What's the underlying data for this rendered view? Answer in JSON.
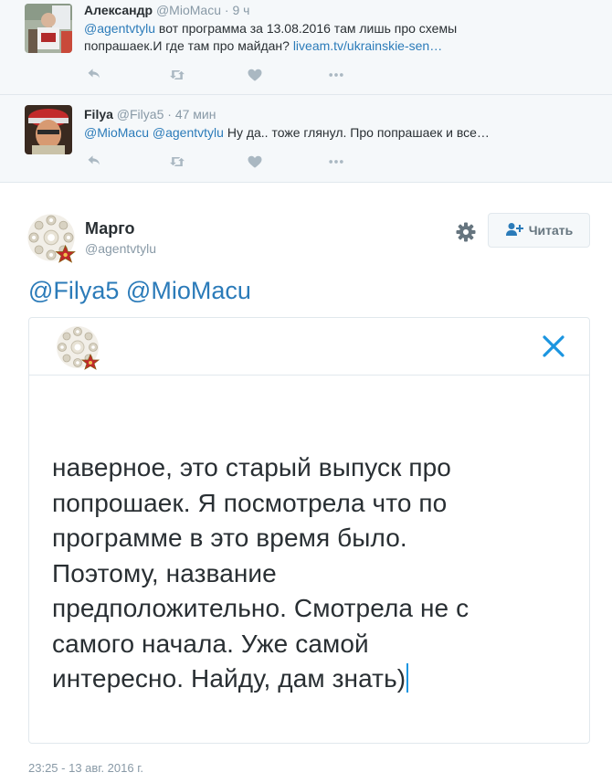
{
  "replies": [
    {
      "name": "Александр",
      "handle": "@MioMacu",
      "time": "9 ч",
      "text_mention": "@agentvtylu",
      "text_body_line1": "  вот программа за 13.08.2016 там лишь про схемы",
      "text_body_line2": "попрашаек.И где там про майдан? ",
      "text_link": "liveam.tv/ukrainskie-sen…"
    },
    {
      "name": "Filya",
      "handle": "@Filya5",
      "time": "47 мин",
      "text_mention": "@MioMacu @agentvtylu",
      "text_body": " Ну да.. тоже глянул. Про попрашаек и все…"
    }
  ],
  "icons": [
    "reply-icon",
    "retweet-icon",
    "like-icon",
    "more-icon",
    "gear-icon",
    "follow-icon",
    "close-icon"
  ],
  "tweet": {
    "name": "Марго",
    "handle": "@agentvtylu",
    "follow_label": "Читать",
    "mentions": "@Filya5 @MioMacu",
    "timestamp": "23:25 - 13 авг. 2016 г."
  },
  "compose": {
    "line1": "наверное, это старый выпуск про",
    "line2": "попрошаек. Я посмотрела что по",
    "line3": "программе в это время было.",
    "line4": "Поэтому, название",
    "line5": "предположительно. Смотрела не с",
    "line6": "самого начала. Уже самой",
    "line7": "интересно. Найду, дам знать)"
  },
  "colors": {
    "link": "#2b7bb9",
    "muted": "#8899a6",
    "text": "#292f33",
    "reply_bg": "#f5f8fa",
    "border": "#e1e8ed",
    "caret": "#1b95e0"
  }
}
